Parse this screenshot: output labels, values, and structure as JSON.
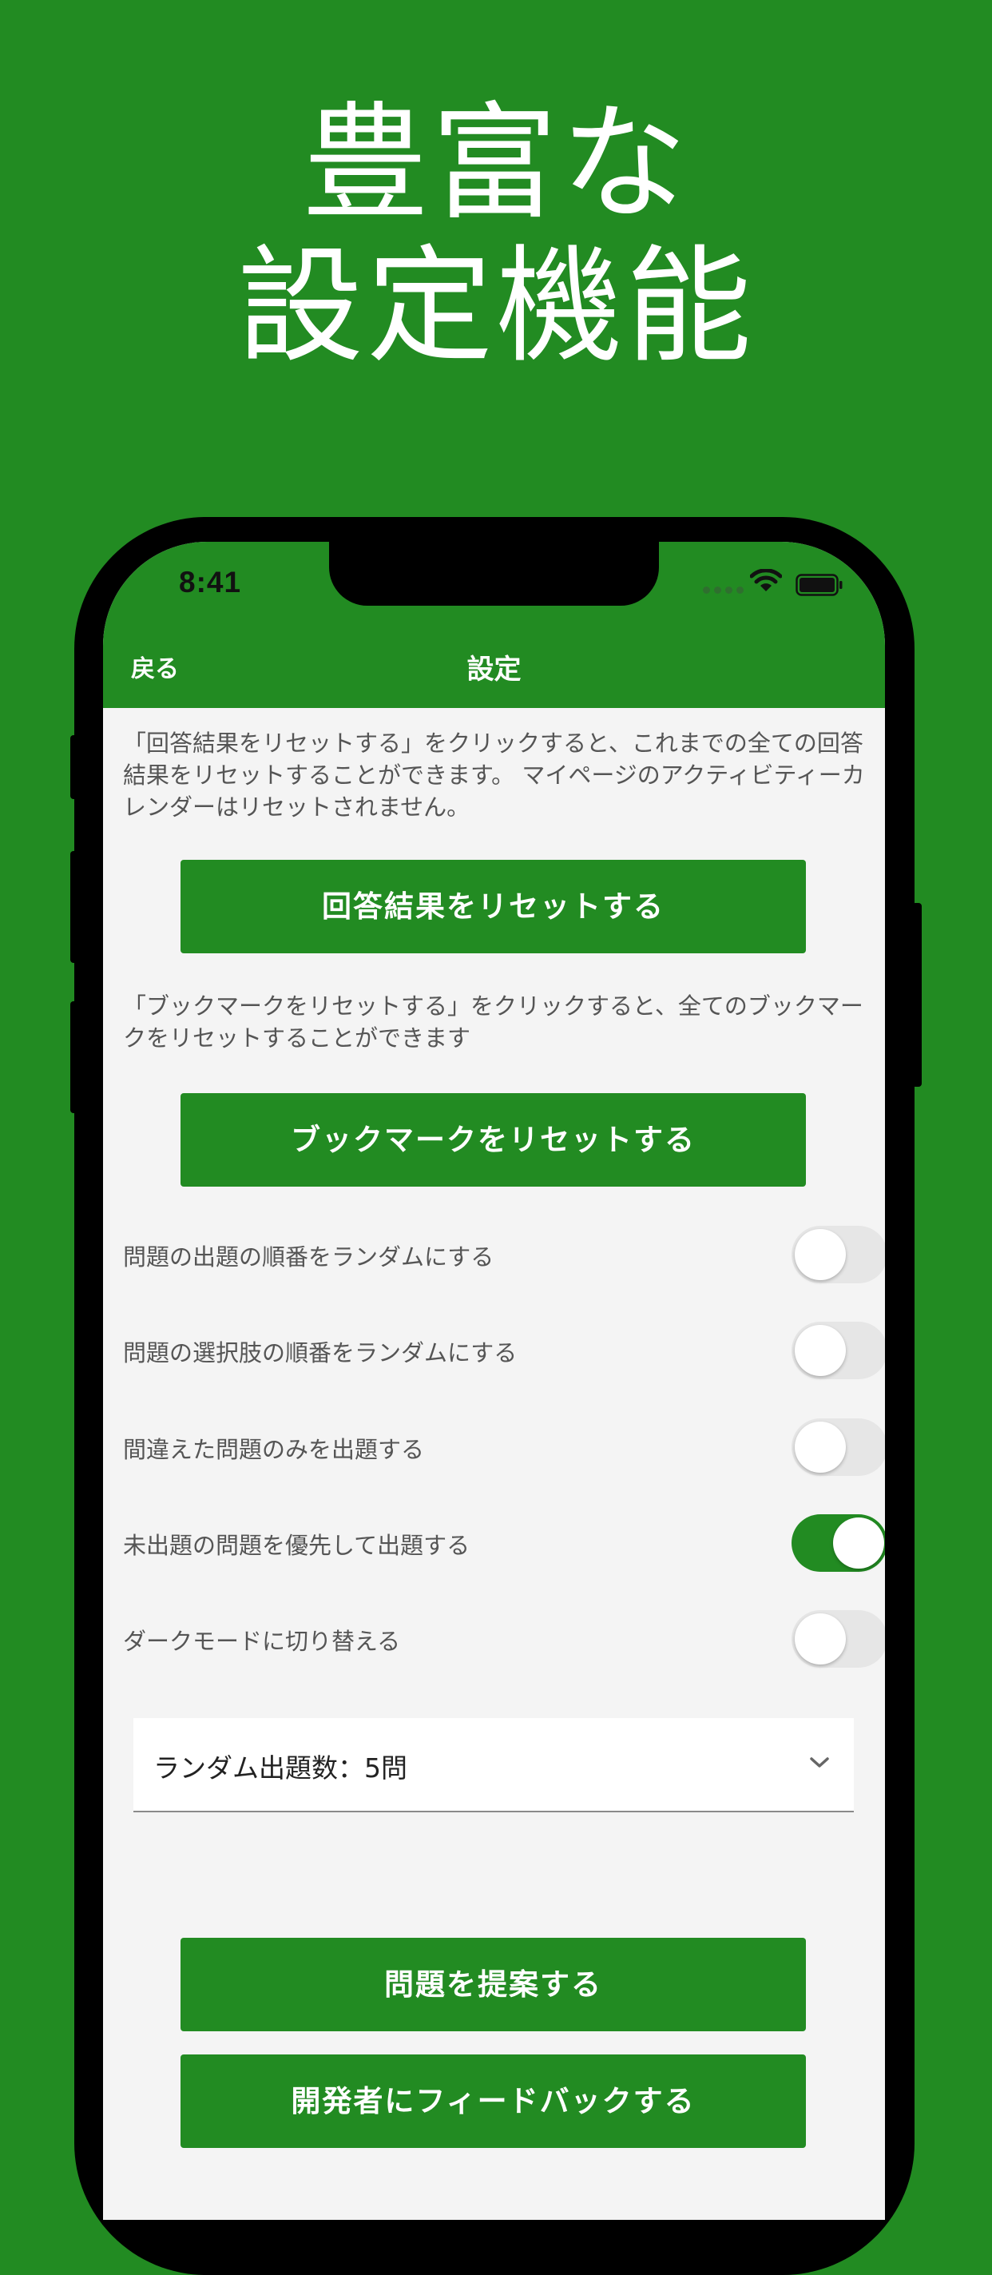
{
  "headline": {
    "line1": "豊富な",
    "line2": "設定機能"
  },
  "status_bar": {
    "time": "8:41"
  },
  "nav": {
    "back": "戻る",
    "title": "設定"
  },
  "reset_answers": {
    "description": "「回答結果をリセットする」をクリックすると、これまでの全ての回答結果をリセットすることができます。 マイページのアクティビティーカレンダーはリセットされません。",
    "button": "回答結果をリセットする"
  },
  "reset_bookmarks": {
    "description": "「ブックマークをリセットする」をクリックすると、全てのブックマークをリセットすることができます",
    "button": "ブックマークをリセットする"
  },
  "toggles": [
    {
      "label": "問題の出題の順番をランダムにする",
      "on": false
    },
    {
      "label": "問題の選択肢の順番をランダムにする",
      "on": false
    },
    {
      "label": "間違えた問題のみを出題する",
      "on": false
    },
    {
      "label": "未出題の問題を優先して出題する",
      "on": true
    },
    {
      "label": "ダークモードに切り替える",
      "on": false
    }
  ],
  "random_count_select": {
    "value": "ランダム出題数：5問"
  },
  "actions": {
    "suggest": "問題を提案する",
    "feedback": "開発者にフィードバックする"
  },
  "colors": {
    "brand_green": "#228B22",
    "screen_background": "#f4f4f4",
    "toggle_off": "#e6e6e6"
  }
}
